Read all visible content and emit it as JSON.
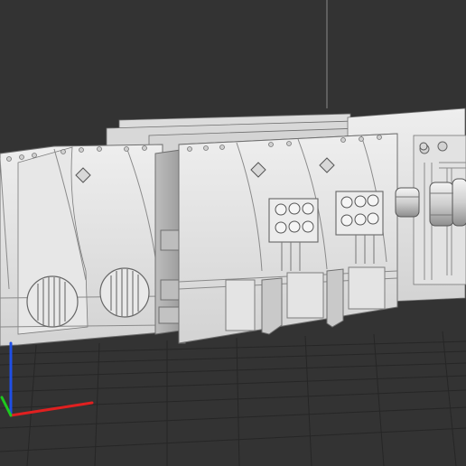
{
  "viewport": {
    "background": "#333333",
    "grid_color": "#262626",
    "model_color": "#e0e0e0",
    "model_shadow": "#a9a9a9",
    "model_outline": "#6f6f6f"
  },
  "model": {
    "name": "sci-fi-wall-panels",
    "panel_count": 4,
    "panel_set_rows": 3
  },
  "axes": {
    "x_color": "#e02020",
    "y_color": "#1ec81e",
    "z_color": "#1f4fe6",
    "vertical_guide_color": "#8a8a8a"
  },
  "icons": {
    "axis_gizmo": "axis-gizmo-icon",
    "vent": "vent-icon",
    "gauge": "gauge-icon",
    "bolt": "bolt-icon",
    "canister": "canister-icon"
  }
}
